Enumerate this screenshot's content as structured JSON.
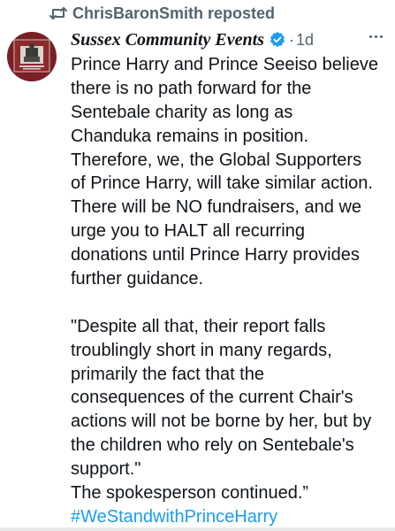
{
  "repost": {
    "label": "ChrisBaronSmith reposted",
    "icon": "repost-icon"
  },
  "author": {
    "display_name": "Sussex Community Events",
    "verified_icon": "verified-badge-icon",
    "separator": "·",
    "timestamp": "1d",
    "avatar_icon": "avatar"
  },
  "more_icon": "more-options-icon",
  "tweet": {
    "paragraph1": [
      "Prince Harry and Prince Seeiso believe",
      "there is no path forward for the",
      "Sentebale charity as long as",
      "Chanduka remains in position.",
      "Therefore, we, the Global Supporters",
      "of Prince Harry, will take similar action.",
      "There will be NO fundraisers, and we",
      "urge you to HALT all recurring",
      "donations until Prince Harry provides",
      "further guidance."
    ],
    "paragraph2": [
      "\"Despite all that, their report falls",
      "troublingly short in many regards,",
      "primarily the fact that the",
      "consequences of the current Chair's",
      "actions will not be borne by her, but by",
      "the children who rely on Sentebale's",
      "support.\"",
      "The spokesperson continued.”"
    ],
    "hashtag": "#WeStandwithPrinceHarry"
  },
  "colors": {
    "text": "#0f1419",
    "secondary": "#536471",
    "link": "#1d9bf0",
    "verified": "#1d9bf0",
    "avatar_background": "#7a1f23"
  }
}
